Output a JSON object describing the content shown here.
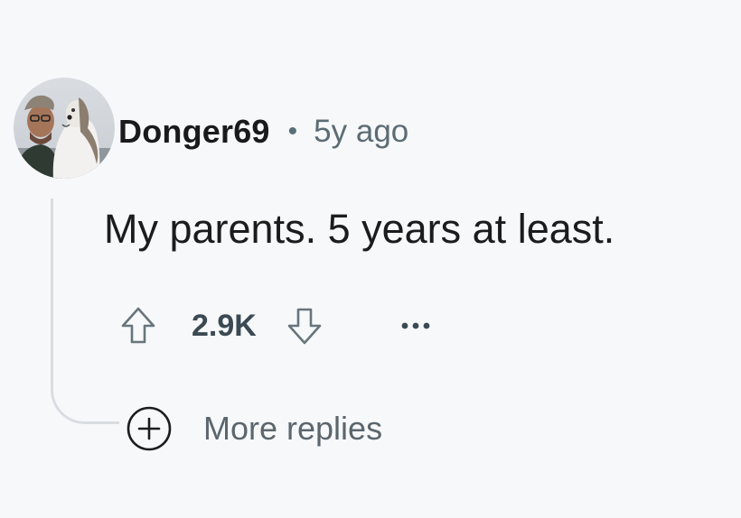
{
  "comment": {
    "author": "Donger69",
    "separator": "•",
    "time_ago": "5y ago",
    "body": "My parents. 5 years at least.",
    "score": "2.9K",
    "more_replies_label": "More replies"
  },
  "icons": {
    "upvote": "arrow-up-outline-icon",
    "downvote": "arrow-down-outline-icon",
    "overflow": "ellipsis-horizontal-icon",
    "expand_replies": "plus-circle-icon"
  },
  "colors": {
    "background": "#f7f8fa",
    "text_primary": "#1c1c1c",
    "text_secondary": "#5c6c74",
    "thread_line": "#d9dde1"
  }
}
